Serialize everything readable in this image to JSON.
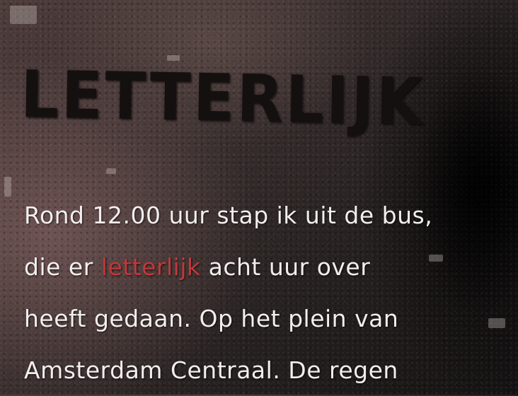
{
  "title": "LETTERLIJK",
  "lines": [
    {
      "text": "Rond 12.00 uur stap ik uit de bus,"
    },
    {
      "before": "die er ",
      "highlight": "letterlijk",
      "after": " acht uur over"
    },
    {
      "text": "heeft gedaan. Op het plein van"
    },
    {
      "text": "Amsterdam Centraal. De regen"
    }
  ],
  "colors": {
    "text": "#f2eeee",
    "highlight": "#c0393a",
    "title": "#141010"
  }
}
